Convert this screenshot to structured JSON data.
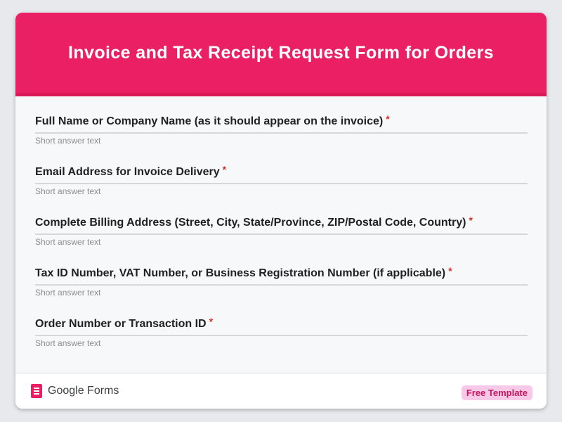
{
  "colors": {
    "header_bg": "#ea1f64",
    "accent": "#e91e63",
    "required_star": "#d93025",
    "badge_bg": "#f8c8e8",
    "badge_text": "#c2185b"
  },
  "form": {
    "title": "Invoice and Tax Receipt Request Form for Orders",
    "required_marker": "*",
    "questions": [
      {
        "label": "Full Name or Company Name (as it should appear on the invoice)",
        "placeholder": "Short answer text",
        "required": true
      },
      {
        "label": "Email Address for Invoice Delivery",
        "placeholder": "Short answer text",
        "required": true
      },
      {
        "label": "Complete Billing Address (Street, City, State/Province, ZIP/Postal Code, Country)",
        "placeholder": "Short answer text",
        "required": true
      },
      {
        "label": "Tax ID Number, VAT Number, or Business Registration Number (if applicable)",
        "placeholder": "Short answer text",
        "required": true
      },
      {
        "label": "Order Number or Transaction ID",
        "placeholder": "Short answer text",
        "required": true
      }
    ]
  },
  "footer": {
    "brand_icon": "google-forms-icon",
    "brand_label": "Google Forms",
    "badge_label": "Free Template"
  }
}
